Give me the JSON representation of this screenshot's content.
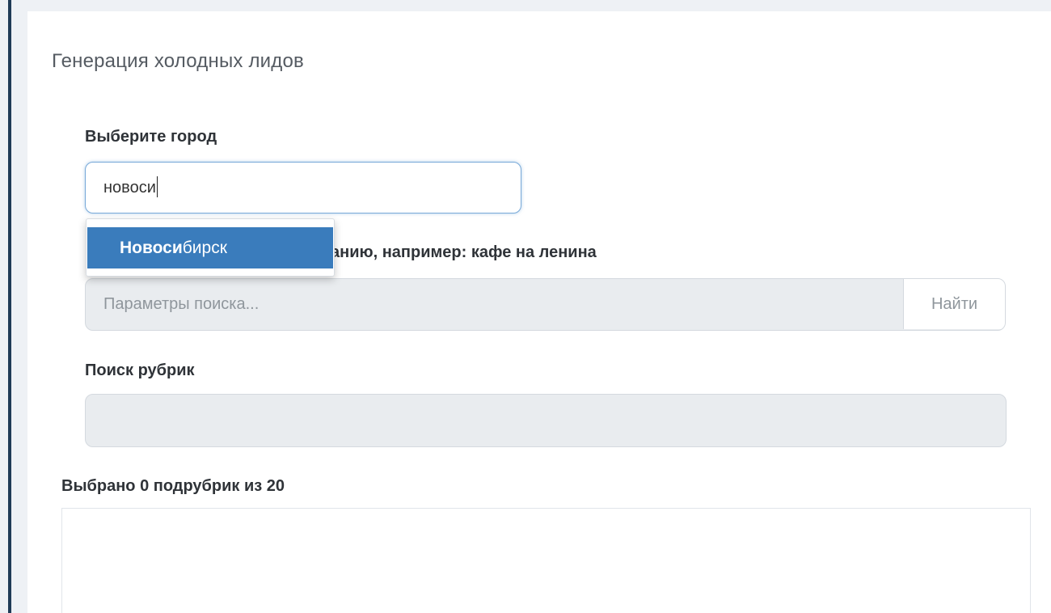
{
  "form": {
    "title": "Генерация холодных лидов",
    "city_label": "Выберите город",
    "city_value": "новоси",
    "autocomplete": {
      "match": "Новоси",
      "rest": "бирск"
    },
    "search_label_visible": "анию, например: кафе на ленина",
    "search_placeholder": "Параметры поиска...",
    "search_button": "Найти",
    "rubric_label": "Поиск рубрик",
    "rubric_value": "",
    "selected_label": "Выбрано 0 подрубрик из 20"
  }
}
